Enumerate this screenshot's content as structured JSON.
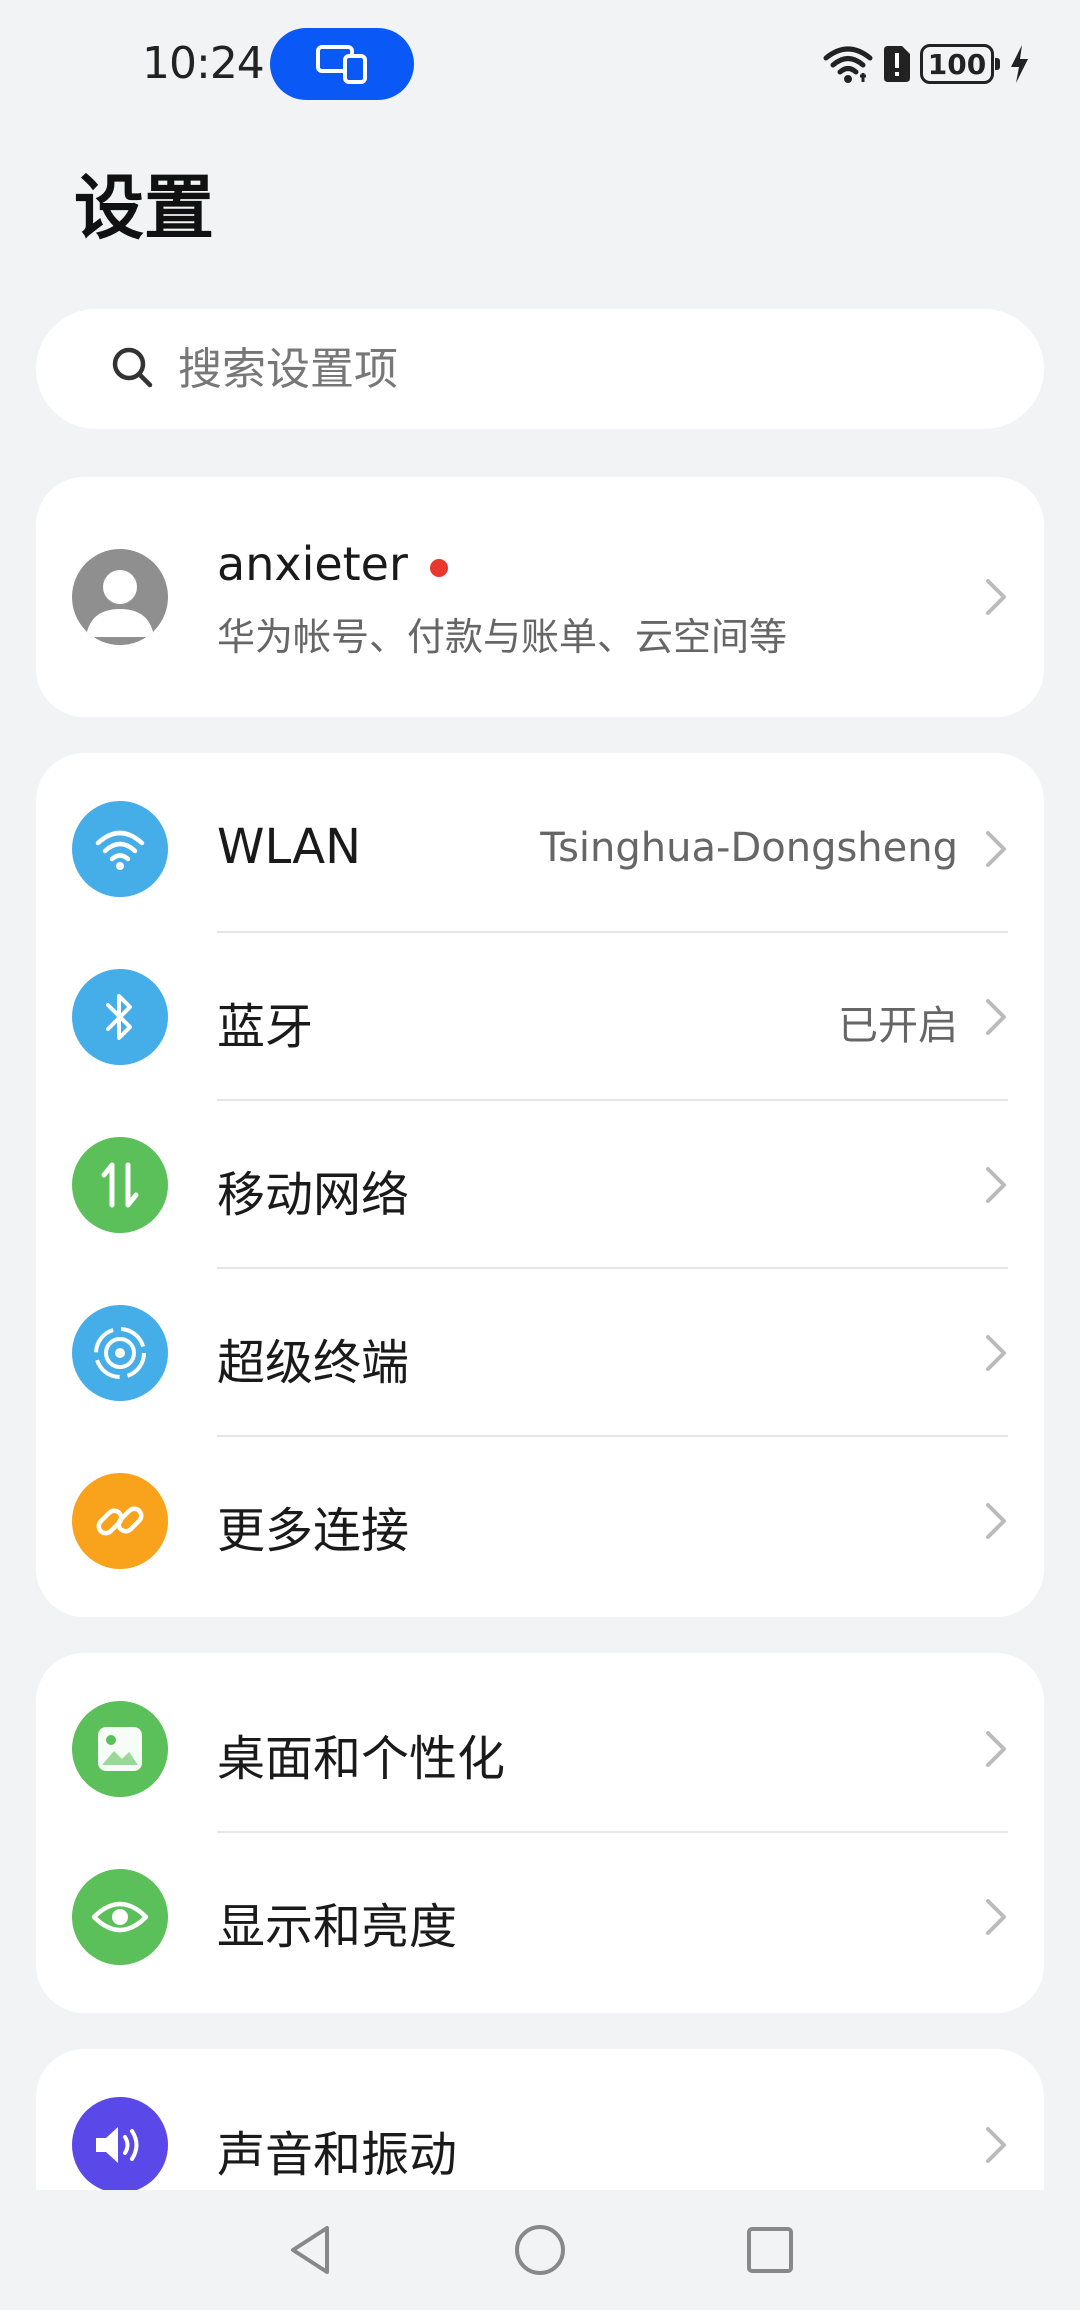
{
  "status_bar": {
    "time": "10:24",
    "battery": "100"
  },
  "header": {
    "title": "设置"
  },
  "search": {
    "placeholder": "搜索设置项"
  },
  "account": {
    "name": "anxieter",
    "subtitle": "华为帐号、付款与账单、云空间等"
  },
  "connectivity": [
    {
      "label": "WLAN",
      "value": "Tsinghua-Dongsheng",
      "icon": "wifi-icon",
      "color": "#45ade7"
    },
    {
      "label": "蓝牙",
      "value": "已开启",
      "icon": "bluetooth-icon",
      "color": "#45ade7"
    },
    {
      "label": "移动网络",
      "value": "",
      "icon": "mobile-data-icon",
      "color": "#5bbf5a"
    },
    {
      "label": "超级终端",
      "value": "",
      "icon": "super-device-icon",
      "color": "#45ade7"
    },
    {
      "label": "更多连接",
      "value": "",
      "icon": "link-icon",
      "color": "#f9a31c"
    }
  ],
  "display": [
    {
      "label": "桌面和个性化",
      "icon": "wallpaper-icon",
      "color": "#5bbf5a"
    },
    {
      "label": "显示和亮度",
      "icon": "eye-icon",
      "color": "#5bbf5a"
    }
  ],
  "sound": [
    {
      "label": "声音和振动",
      "icon": "speaker-icon",
      "color": "#5a48e9"
    }
  ]
}
